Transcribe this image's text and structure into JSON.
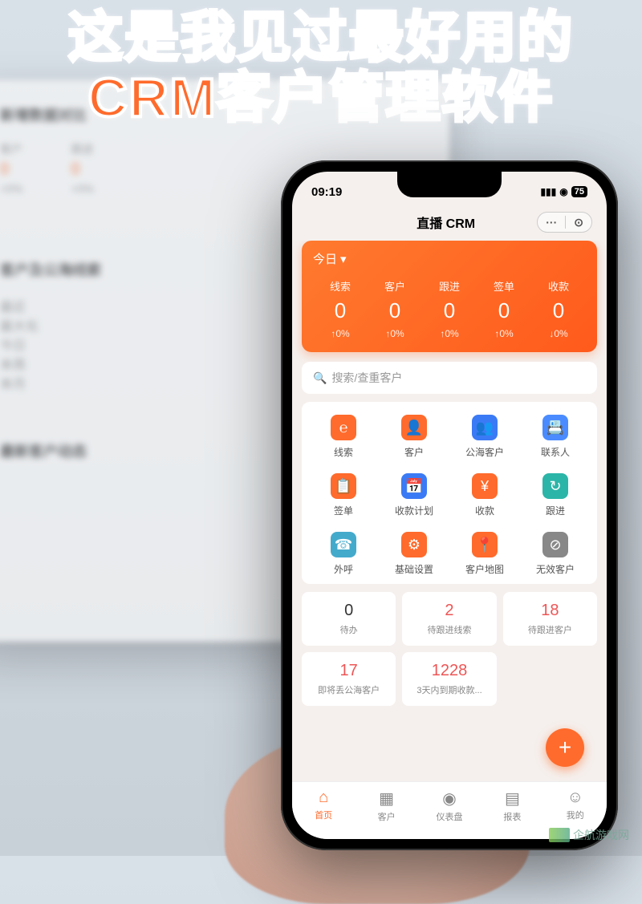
{
  "overlay": {
    "headline_line1": "这是我见过最好用的",
    "headline_line2": "CRM客户管理软件"
  },
  "background_monitor": {
    "section1_title": "新增数据对比",
    "cols": [
      {
        "label": "客户",
        "value": "0",
        "change": "+0%"
      },
      {
        "label": "跟进",
        "value": "0",
        "change": "+0%"
      }
    ],
    "section2_title": "客户及公海线索",
    "section2_items": [
      "最近",
      "最大化",
      "今日",
      "本周",
      "本月"
    ],
    "section3_title": "最新客户动态"
  },
  "status_bar": {
    "time": "09:19",
    "battery": "75"
  },
  "header": {
    "title": "直播 CRM",
    "menu_icon": "···",
    "target_icon": "⊙"
  },
  "stats": {
    "period_label": "今日",
    "metrics": [
      {
        "label": "线索",
        "value": "0",
        "change": "↑0%"
      },
      {
        "label": "客户",
        "value": "0",
        "change": "↑0%"
      },
      {
        "label": "跟进",
        "value": "0",
        "change": "↑0%"
      },
      {
        "label": "签单",
        "value": "0",
        "change": "↑0%"
      },
      {
        "label": "收款",
        "value": "0",
        "change": "↓0%"
      }
    ]
  },
  "search": {
    "placeholder": "搜索/查重客户",
    "icon": "🔍"
  },
  "menu_grid": [
    {
      "label": "线索",
      "icon": "℮",
      "color": "c-orange"
    },
    {
      "label": "客户",
      "icon": "👤",
      "color": "c-orange"
    },
    {
      "label": "公海客户",
      "icon": "👥",
      "color": "c-blue"
    },
    {
      "label": "联系人",
      "icon": "📇",
      "color": "c-blue2"
    },
    {
      "label": "签单",
      "icon": "📋",
      "color": "c-orange"
    },
    {
      "label": "收款计划",
      "icon": "📅",
      "color": "c-blue"
    },
    {
      "label": "收款",
      "icon": "¥",
      "color": "c-orange"
    },
    {
      "label": "跟进",
      "icon": "↻",
      "color": "c-teal"
    },
    {
      "label": "外呼",
      "icon": "☎",
      "color": "c-cyan"
    },
    {
      "label": "基础设置",
      "icon": "⚙",
      "color": "c-orange"
    },
    {
      "label": "客户地图",
      "icon": "📍",
      "color": "c-orange"
    },
    {
      "label": "无效客户",
      "icon": "⊘",
      "color": "c-gray"
    }
  ],
  "summary": [
    {
      "value": "0",
      "label": "待办",
      "color": "c-dark"
    },
    {
      "value": "2",
      "label": "待跟进线索",
      "color": "c-red-t"
    },
    {
      "value": "18",
      "label": "待跟进客户",
      "color": "c-red-t"
    },
    {
      "value": "17",
      "label": "即将丢公海客户",
      "color": "c-red-t"
    },
    {
      "value": "1228",
      "label": "3天内到期收款...",
      "color": "c-red-t"
    }
  ],
  "fab": {
    "icon": "+"
  },
  "tabs": [
    {
      "icon": "⌂",
      "label": "首页",
      "active": true
    },
    {
      "icon": "▦",
      "label": "客户",
      "active": false
    },
    {
      "icon": "◉",
      "label": "仪表盘",
      "active": false
    },
    {
      "icon": "▤",
      "label": "报表",
      "active": false
    },
    {
      "icon": "☺",
      "label": "我的",
      "active": false
    }
  ],
  "watermark": {
    "text": "企航游戏网"
  }
}
